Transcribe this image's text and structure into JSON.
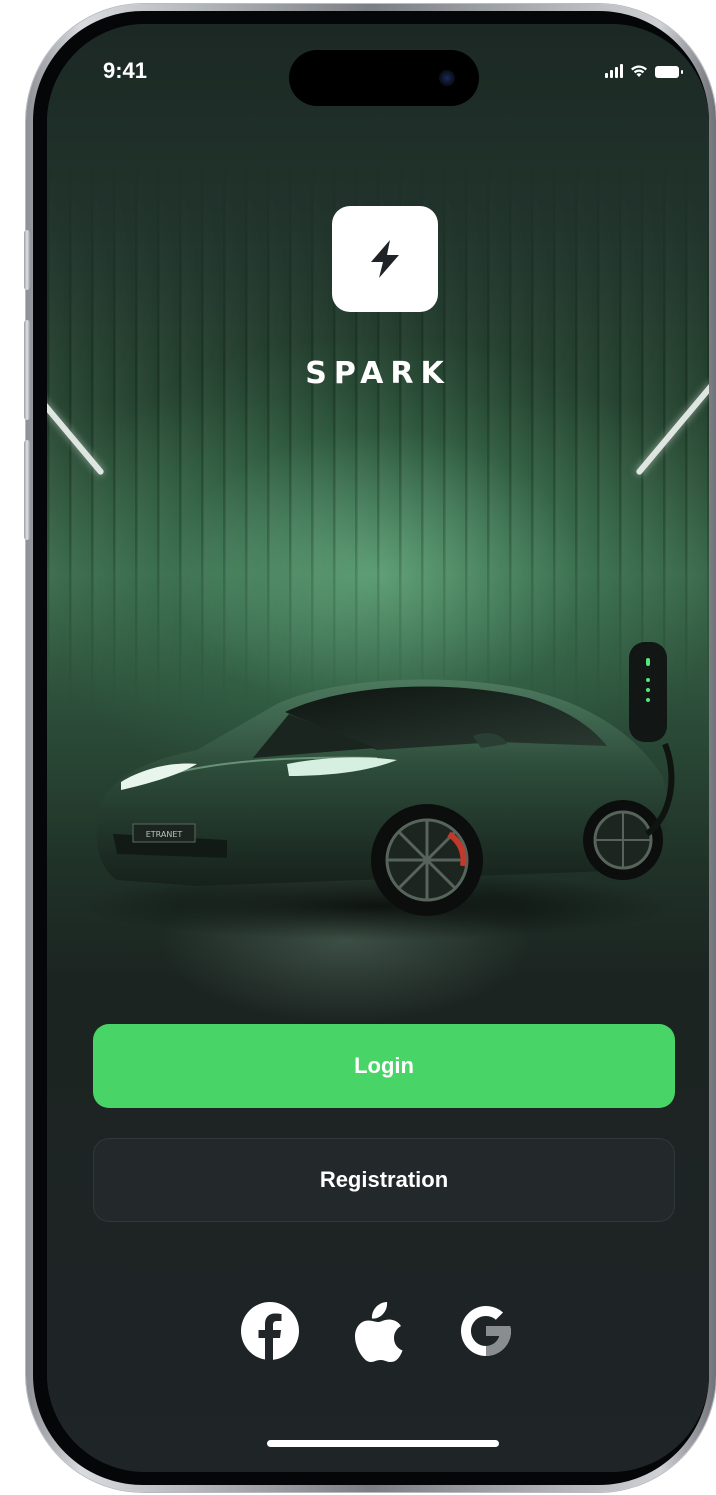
{
  "status_bar": {
    "time": "9:41",
    "icons": [
      "cellular-signal-icon",
      "wifi-icon",
      "battery-icon"
    ]
  },
  "app": {
    "brand_name": "SPARK",
    "logo_icon": "lightning-bolt-icon",
    "license_plate": "ETRANET"
  },
  "actions": {
    "login_label": "Login",
    "registration_label": "Registration"
  },
  "social_login": [
    "facebook-icon",
    "apple-icon",
    "google-icon"
  ],
  "colors": {
    "accent_green": "#48d466",
    "background_dark": "#20262a",
    "text": "#ffffff"
  }
}
